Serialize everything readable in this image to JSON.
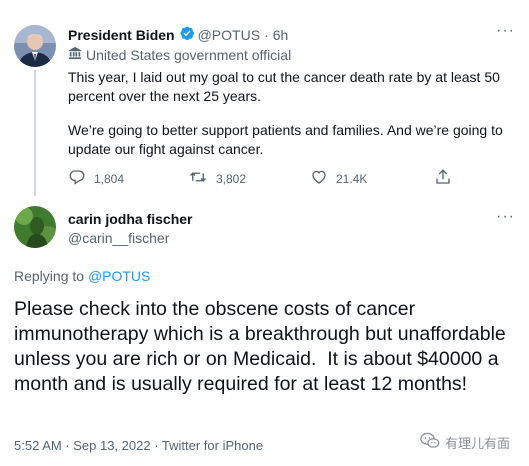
{
  "tweet": {
    "author_name": "President Biden",
    "handle": "@POTUS",
    "separator": "·",
    "time": "6h",
    "gov_label": "United States government official",
    "body_p1": "This year, I laid out my goal to cut the cancer death rate by at least 50 percent over the next 25 years.",
    "body_p2": "We’re going to better support patients and families. And we’re going to update our fight against cancer.",
    "replies": "1,804",
    "retweets": "3,802",
    "likes": "21.4K",
    "more": "···"
  },
  "reply": {
    "author_name": "carin jodha fischer",
    "handle": "@carin__fischer",
    "replying_prefix": "Replying to",
    "replying_to": "@POTUS",
    "body": "Please check into the obscene costs of cancer immunotherapy which is a breakthrough but unaffordable unless you are rich or on Medicaid.  It is about $40000 a month and is usually required for at least 12 months!",
    "timestamp": "5:52 AM · Sep 13, 2022 · Twitter for iPhone",
    "more": "···"
  },
  "watermark": "有理儿有面",
  "colors": {
    "verified": "#1d9bf0",
    "link": "#1d9bf0",
    "secondary_text": "#536471"
  }
}
